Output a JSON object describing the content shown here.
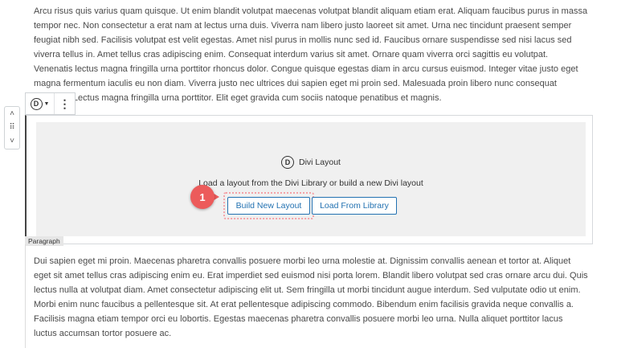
{
  "paragraphs": {
    "top": "Arcu risus quis varius quam quisque. Ut enim blandit volutpat maecenas volutpat blandit aliquam etiam erat. Aliquam faucibus purus in massa tempor nec. Non consectetur a erat nam at lectus urna duis. Viverra nam libero justo laoreet sit amet. Urna nec tincidunt praesent semper feugiat nibh sed. Facilisis volutpat est velit egestas. Amet nisl purus in mollis nunc sed id. Faucibus ornare suspendisse sed nisi lacus sed viverra tellus in. Amet tellus cras adipiscing enim. Consequat interdum varius sit amet. Ornare quam viverra orci sagittis eu volutpat. Venenatis lectus magna fringilla urna porttitor rhoncus dolor. Congue quisque egestas diam in arcu cursus euismod. Integer vitae justo eget magna fermentum iaculis eu non diam. Viverra justo nec ultrices dui sapien eget mi proin sed. Malesuada proin libero nunc consequat interdum. Lectus magna fringilla urna porttitor. Elit eget gravida cum sociis natoque penatibus et magnis.",
    "bottom": "Dui sapien eget mi proin. Maecenas pharetra convallis posuere morbi leo urna molestie at. Dignissim convallis aenean et tortor at. Aliquet eget sit amet tellus cras adipiscing enim eu. Erat imperdiet sed euismod nisi porta lorem. Blandit libero volutpat sed cras ornare arcu dui. Quis lectus nulla at volutpat diam. Amet consectetur adipiscing elit ut. Sem fringilla ut morbi tincidunt augue interdum. Sed vulputate odio ut enim. Morbi enim nunc faucibus a pellentesque sit. At erat pellentesque adipiscing commodo. Bibendum enim facilisis gravida neque convallis a. Facilisis magna etiam tempor orci eu lobortis. Egestas maecenas pharetra convallis posuere morbi leo urna. Nulla aliquet porttitor lacus luctus accumsan tortor posuere ac."
  },
  "mover": {
    "up": "˄",
    "drag": "⠿",
    "down": "˅"
  },
  "toolbar": {
    "divi_glyph": "D",
    "caret": "▼",
    "more": "⋮"
  },
  "divi_block": {
    "logo_glyph": "D",
    "title": "Divi Layout",
    "description": "Load a layout from the Divi Library or build a new Divi layout",
    "build_button": "Build New Layout",
    "library_button": "Load From Library",
    "callout_number": "1",
    "block_label": "Paragraph"
  },
  "colors": {
    "accent": "#2271b1",
    "callout": "#ec5b5b",
    "placeholder_bg": "#f0f0f0"
  }
}
